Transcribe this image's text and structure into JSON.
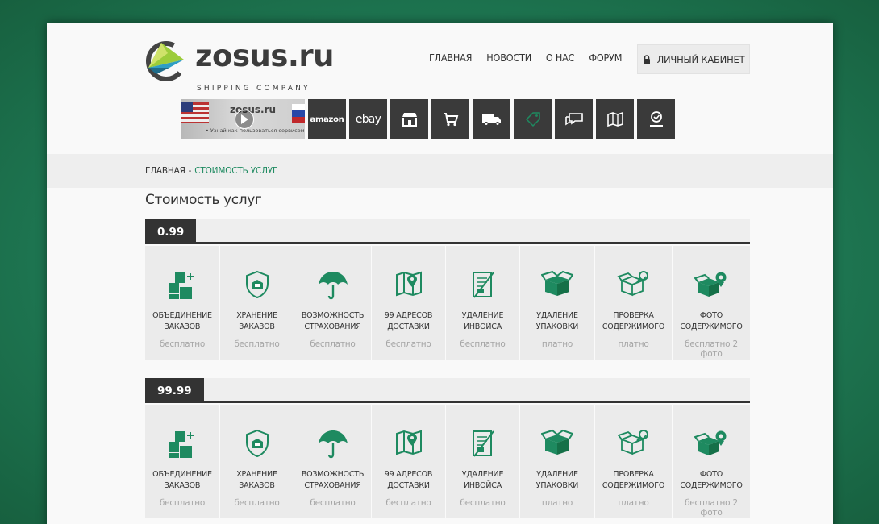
{
  "brand": {
    "name": "zosus.ru",
    "tagline": "SHIPPING COMPANY"
  },
  "nav": {
    "items": [
      "ГЛАВНАЯ",
      "НОВОСТИ",
      "О НАС",
      "ФОРУМ"
    ],
    "cabinet_label": "ЛИЧНЫЙ КАБИНЕТ"
  },
  "video": {
    "title": "zosus.ru",
    "subtitle": "COMPANY",
    "caption": "• Узнай как пользоваться сервисом"
  },
  "tiles": {
    "amazon": "amazon",
    "ebay": "ebay",
    "icons": [
      "store-icon",
      "cart-icon",
      "truck-icon",
      "tag-icon",
      "chat-icon",
      "map-icon",
      "location-icon"
    ]
  },
  "breadcrumb": {
    "home": "ГЛАВНАЯ",
    "separator": "-",
    "current": "СТОИМОСТЬ УСЛУГ"
  },
  "page_title": "Стоимость услуг",
  "colors": {
    "accent": "#1e8a60",
    "dark": "#333333"
  },
  "sections": [
    {
      "price": "0.99",
      "services": [
        {
          "icon": "boxes-merge-icon",
          "label": "ОБЪЕДИНЕНИЕ\nЗАКАЗОВ",
          "price": "бесплатно"
        },
        {
          "icon": "shield-storage-icon",
          "label": "ХРАНЕНИЕ\nЗАКАЗОВ",
          "price": "бесплатно"
        },
        {
          "icon": "umbrella-icon",
          "label": "ВОЗМОЖНОСТЬ\nСТРАХОВАНИЯ",
          "price": "бесплатно"
        },
        {
          "icon": "map-pin-icon",
          "label": "99 АДРЕСОВ\nДОСТАВКИ",
          "price": "бесплатно"
        },
        {
          "icon": "invoice-remove-icon",
          "label": "УДАЛЕНИЕ\nИНВОЙСА",
          "price": "бесплатно"
        },
        {
          "icon": "open-box-icon",
          "label": "УДАЛЕНИЕ\nУПАКОВКИ",
          "price": "платно"
        },
        {
          "icon": "box-inspect-icon",
          "label": "ПРОВЕРКА\nСОДЕРЖИМОГО",
          "price": "платно"
        },
        {
          "icon": "box-photo-icon",
          "label": "ФОТО\nСОДЕРЖИМОГО",
          "price": "бесплатно 2 фото"
        }
      ]
    },
    {
      "price": "99.99",
      "services": [
        {
          "icon": "boxes-merge-icon",
          "label": "ОБЪЕДИНЕНИЕ\nЗАКАЗОВ",
          "price": "бесплатно"
        },
        {
          "icon": "shield-storage-icon",
          "label": "ХРАНЕНИЕ\nЗАКАЗОВ",
          "price": "бесплатно"
        },
        {
          "icon": "umbrella-icon",
          "label": "ВОЗМОЖНОСТЬ\nСТРАХОВАНИЯ",
          "price": "бесплатно"
        },
        {
          "icon": "map-pin-icon",
          "label": "99 АДРЕСОВ\nДОСТАВКИ",
          "price": "бесплатно"
        },
        {
          "icon": "invoice-remove-icon",
          "label": "УДАЛЕНИЕ\nИНВОЙСА",
          "price": "бесплатно"
        },
        {
          "icon": "open-box-icon",
          "label": "УДАЛЕНИЕ\nУПАКОВКИ",
          "price": "платно"
        },
        {
          "icon": "box-inspect-icon",
          "label": "ПРОВЕРКА\nСОДЕРЖИМОГО",
          "price": "платно"
        },
        {
          "icon": "box-photo-icon",
          "label": "ФОТО\nСОДЕРЖИМОГО",
          "price": "бесплатно 2 фото"
        }
      ]
    }
  ]
}
